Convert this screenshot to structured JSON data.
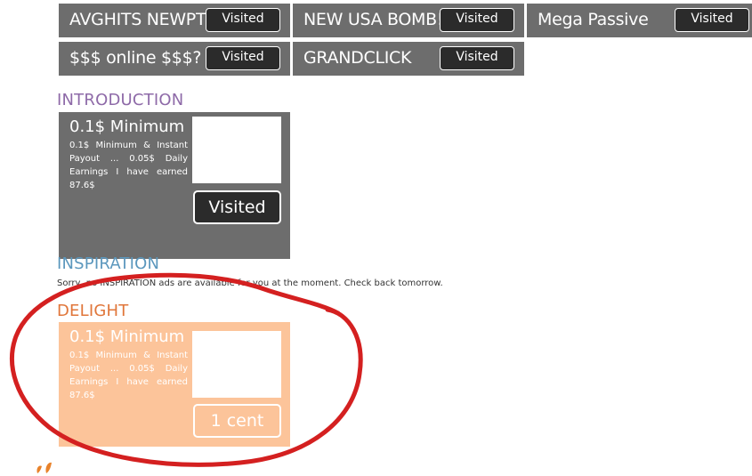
{
  "top_tiles": [
    {
      "title": "AVGHITS NEWPTC",
      "button": "Visited"
    },
    {
      "title": "NEW USA BOMB!",
      "button": "Visited"
    },
    {
      "title": "Mega Passive",
      "button": "Visited"
    },
    {
      "title": "$$$ online $$$?",
      "button": "Visited"
    },
    {
      "title": "GRANDCLICK",
      "button": "Visited"
    }
  ],
  "sections": {
    "introduction": {
      "heading": "INTRODUCTION",
      "color": "#8e6aa8",
      "card": {
        "title": "0.1$ Minimum",
        "description": "0.1$ Minimum & Instant Payout ... 0.05$ Daily Earnings I have earned 87.6$",
        "button": "Visited",
        "background": "#6d6d6d"
      }
    },
    "inspiration": {
      "heading": "INSPIRATION",
      "color": "#5b97bd",
      "notice": "Sorry, no INSPIRATION ads are available for you at the moment. Check back tomorrow."
    },
    "delight": {
      "heading": "DELIGHT",
      "color": "#e0763a",
      "card": {
        "title": "0.1$ Minimum",
        "description": "0.1$ Minimum & Instant Payout ... 0.05$ Daily Earnings I have earned 87.6$",
        "button": "1 cent",
        "background": "#fcc49a"
      }
    }
  },
  "annotation": {
    "shape": "hand-drawn circle",
    "color": "#d42020"
  },
  "icons": [
    "leaf-logo-icon"
  ]
}
